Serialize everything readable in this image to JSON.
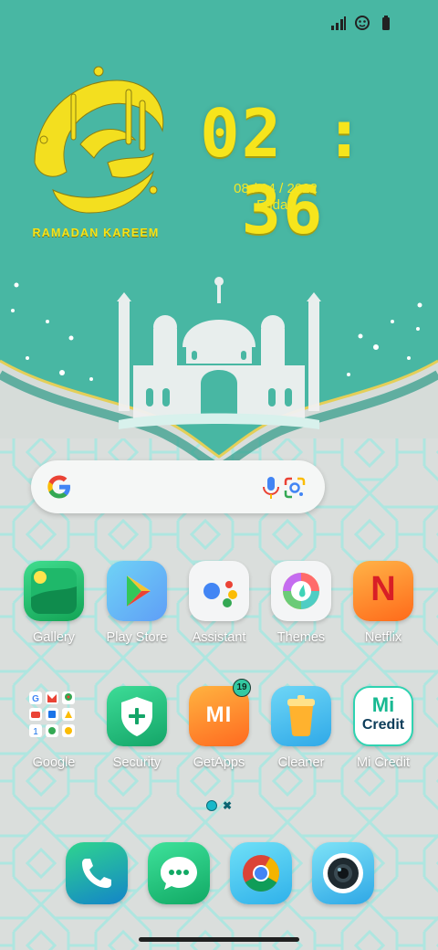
{
  "status_bar": {
    "icons": [
      "signal-icon",
      "face-icon",
      "battery-icon"
    ]
  },
  "widget": {
    "time": "02 : 36",
    "date": "08 / 04 / 2022",
    "day": "Friday",
    "banner_text": "RAMADAN KAREEM"
  },
  "search": {
    "icons": [
      "google-g-icon",
      "microphone-icon",
      "google-lens-icon"
    ]
  },
  "apps_row1": [
    {
      "label": "Gallery",
      "icon": "gallery-icon"
    },
    {
      "label": "Play Store",
      "icon": "play-store-icon"
    },
    {
      "label": "Assistant",
      "icon": "assistant-icon"
    },
    {
      "label": "Themes",
      "icon": "themes-icon"
    },
    {
      "label": "Netflix",
      "icon": "netflix-icon",
      "glyph": "N"
    }
  ],
  "apps_row2": [
    {
      "label": "Google",
      "icon": "google-folder-icon"
    },
    {
      "label": "Security",
      "icon": "security-icon",
      "glyph": "+"
    },
    {
      "label": "GetApps",
      "icon": "getapps-icon",
      "glyph": "MI",
      "badge": "19"
    },
    {
      "label": "Cleaner",
      "icon": "cleaner-icon"
    },
    {
      "label": "Mi Credit",
      "icon": "mi-credit-icon",
      "glyph_top": "Mi",
      "glyph_bottom": "Credit"
    }
  ],
  "page_indicator": {
    "active": 1,
    "total": 2
  },
  "dock": [
    {
      "icon": "phone-icon"
    },
    {
      "icon": "messages-icon"
    },
    {
      "icon": "chrome-icon"
    },
    {
      "icon": "camera-icon"
    }
  ],
  "colors": {
    "teal": "#4bbaa6",
    "gold": "#f6e51c",
    "background": "#d6dcd9"
  }
}
